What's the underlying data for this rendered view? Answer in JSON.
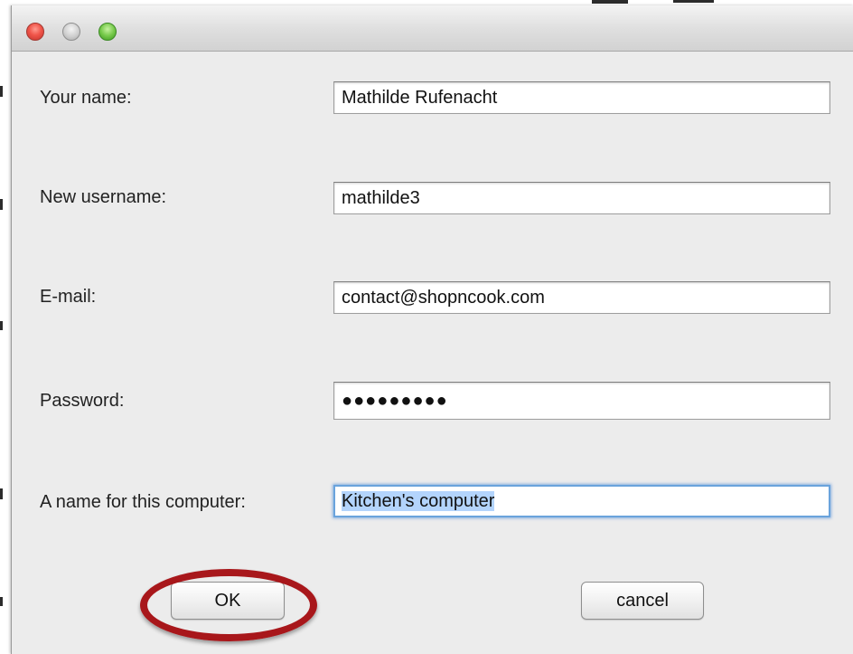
{
  "window": {
    "controls": [
      "close-button",
      "minimize-button",
      "zoom-button"
    ]
  },
  "form": {
    "name_label": "Your name:",
    "name_value": "Mathilde Rufenacht",
    "username_label": "New username:",
    "username_value": "mathilde3",
    "email_label": "E-mail:",
    "email_value": "contact@shopncook.com",
    "password_label": "Password:",
    "password_value": "●●●●●●●●●",
    "computer_label": "A name for this computer:",
    "computer_value": "Kitchen's computer"
  },
  "buttons": {
    "ok_label": "OK",
    "cancel_label": "cancel"
  },
  "colors": {
    "highlight_ring": "#a8171b",
    "focus_ring": "#6aa3dc",
    "selection": "#b3d4fc"
  }
}
